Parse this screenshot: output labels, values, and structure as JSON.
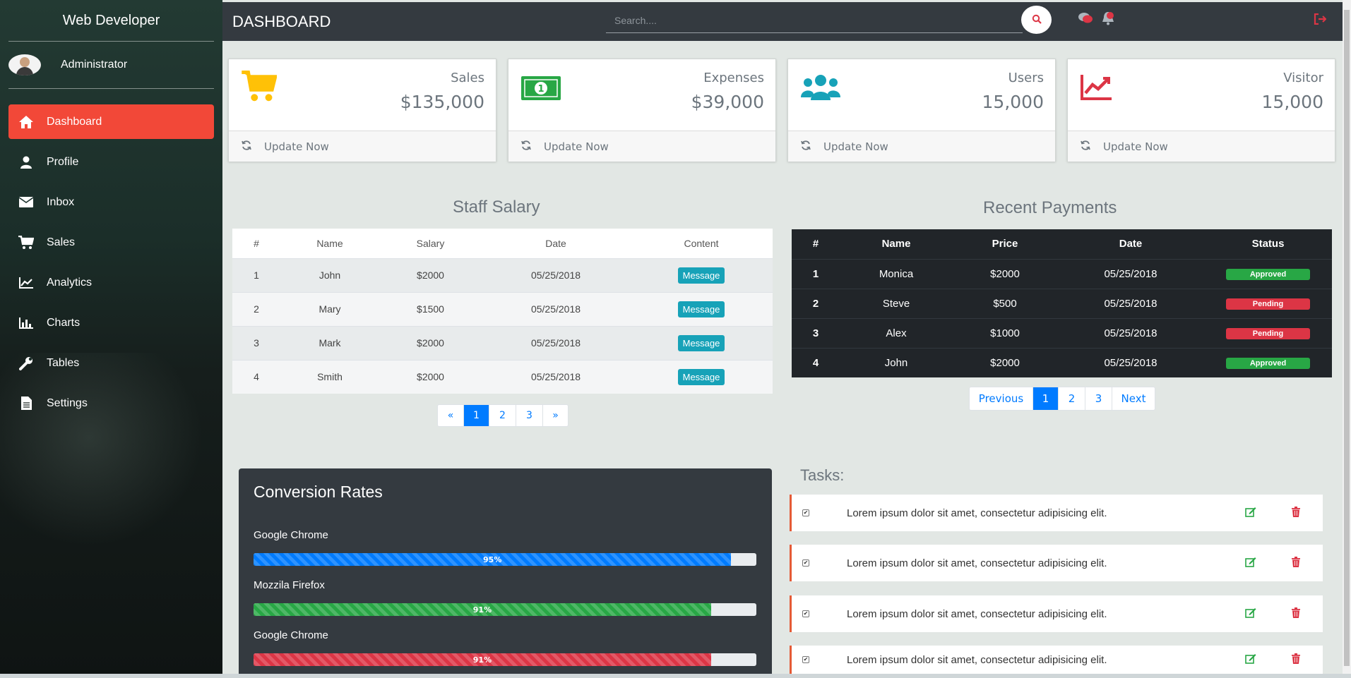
{
  "sidebar": {
    "brand": "Web Developer",
    "user": "Administrator",
    "items": [
      {
        "label": "Dashboard",
        "icon": "home-icon"
      },
      {
        "label": "Profile",
        "icon": "user-icon"
      },
      {
        "label": "Inbox",
        "icon": "envelope-icon"
      },
      {
        "label": "Sales",
        "icon": "cart-icon"
      },
      {
        "label": "Analytics",
        "icon": "line-chart-icon"
      },
      {
        "label": "Charts",
        "icon": "bar-chart-icon"
      },
      {
        "label": "Tables",
        "icon": "wrench-icon"
      },
      {
        "label": "Settings",
        "icon": "file-icon"
      }
    ]
  },
  "header": {
    "title": "DASHBOARD",
    "search_placeholder": "Search....",
    "icons": [
      "search-icon",
      "comments-icon",
      "bell-icon",
      "sign-out-icon"
    ]
  },
  "cards": [
    {
      "label": "Sales",
      "value": "$135,000",
      "footer": "Update Now",
      "icon": "cart-icon",
      "color": "#ffc107"
    },
    {
      "label": "Expenses",
      "value": "$39,000",
      "footer": "Update Now",
      "icon": "money-icon",
      "color": "#28a745"
    },
    {
      "label": "Users",
      "value": "15,000",
      "footer": "Update Now",
      "icon": "users-icon",
      "color": "#17a2b8"
    },
    {
      "label": "Visitor",
      "value": "15,000",
      "footer": "Update Now",
      "icon": "line-chart-icon",
      "color": "#dc3545"
    }
  ],
  "staff": {
    "title": "Staff Salary",
    "headers": [
      "#",
      "Name",
      "Salary",
      "Date",
      "Content"
    ],
    "rows": [
      {
        "num": "1",
        "name": "John",
        "salary": "$2000",
        "date": "05/25/2018",
        "action": "Message"
      },
      {
        "num": "2",
        "name": "Mary",
        "salary": "$1500",
        "date": "05/25/2018",
        "action": "Message"
      },
      {
        "num": "3",
        "name": "Mark",
        "salary": "$2000",
        "date": "05/25/2018",
        "action": "Message"
      },
      {
        "num": "4",
        "name": "Smith",
        "salary": "$2000",
        "date": "05/25/2018",
        "action": "Message"
      }
    ],
    "pager": [
      "«",
      "1",
      "2",
      "3",
      "»"
    ]
  },
  "payments": {
    "title": "Recent Payments",
    "headers": [
      "#",
      "Name",
      "Price",
      "Date",
      "Status"
    ],
    "rows": [
      {
        "num": "1",
        "name": "Monica",
        "price": "$2000",
        "date": "05/25/2018",
        "status": "Approved"
      },
      {
        "num": "2",
        "name": "Steve",
        "price": "$500",
        "date": "05/25/2018",
        "status": "Pending"
      },
      {
        "num": "3",
        "name": "Alex",
        "price": "$1000",
        "date": "05/25/2018",
        "status": "Pending"
      },
      {
        "num": "4",
        "name": "John",
        "price": "$2000",
        "date": "05/25/2018",
        "status": "Approved"
      }
    ],
    "pager": [
      "Previous",
      "1",
      "2",
      "3",
      "Next"
    ]
  },
  "conversion": {
    "title": "Conversion Rates",
    "bars": [
      {
        "label": "Google Chrome",
        "value": 95,
        "text": "95%",
        "color": "#007bff"
      },
      {
        "label": "Mozzila Firefox",
        "value": 91,
        "text": "91%",
        "color": "#28a745"
      },
      {
        "label": "Google Chrome",
        "value": 91,
        "text": "91%",
        "color": "#dc3545"
      }
    ]
  },
  "tasks": {
    "title": "Tasks:",
    "items": [
      {
        "text": "Lorem ipsum dolor sit amet, consectetur adipisicing elit.",
        "checked": true
      },
      {
        "text": "Lorem ipsum dolor sit amet, consectetur adipisicing elit.",
        "checked": true
      },
      {
        "text": "Lorem ipsum dolor sit amet, consectetur adipisicing elit.",
        "checked": true
      },
      {
        "text": "Lorem ipsum dolor sit amet, consectetur adipisicing elit.",
        "checked": true
      }
    ]
  }
}
